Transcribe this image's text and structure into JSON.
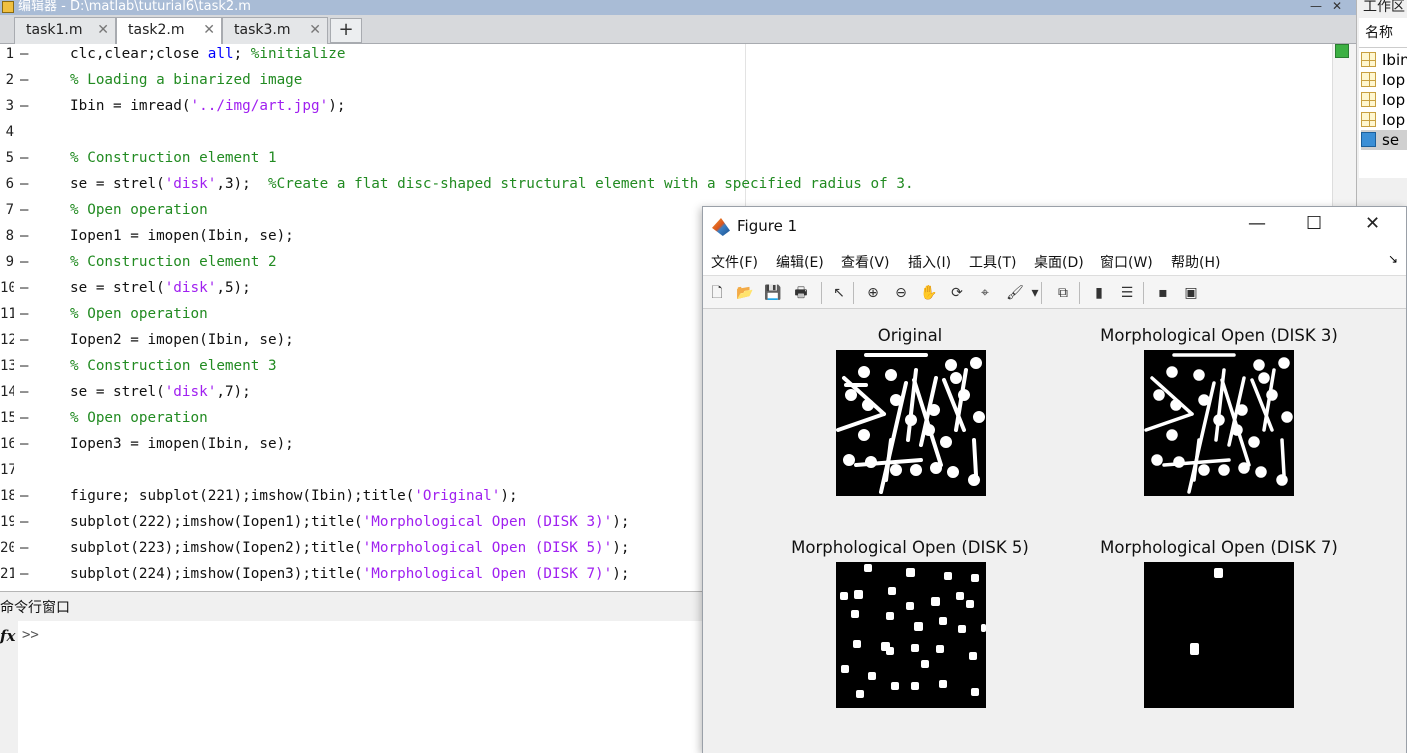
{
  "editor": {
    "title": "编辑器 - D:\\matlab\\tuturial6\\task2.m",
    "window_controls": {
      "minimize": "—",
      "close": "✕"
    },
    "tabs": [
      {
        "label": "task1.m",
        "active": false
      },
      {
        "label": "task2.m",
        "active": true
      },
      {
        "label": "task3.m",
        "active": false
      }
    ],
    "tab_close": "✕",
    "add_tab": "+",
    "line_numbers": [
      "1",
      "2",
      "3",
      "4",
      "5",
      "6",
      "7",
      "8",
      "9",
      "10",
      "11",
      "12",
      "13",
      "14",
      "15",
      "16",
      "17",
      "18",
      "19",
      "20",
      "21"
    ],
    "line_marker": "—"
  },
  "code_lines": [
    [
      [
        "p",
        "clc,clear;close "
      ],
      [
        "kw",
        "all"
      ],
      [
        "p",
        "; "
      ],
      [
        "cm",
        "%initialize"
      ]
    ],
    [
      [
        "cm",
        "% Loading a binarized image"
      ]
    ],
    [
      [
        "p",
        "Ibin = imread("
      ],
      [
        "st",
        "'../img/art.jpg'"
      ],
      [
        "p",
        ");"
      ]
    ],
    [],
    [
      [
        "cm",
        "% Construction element 1"
      ]
    ],
    [
      [
        "p",
        "se = strel("
      ],
      [
        "st",
        "'disk'"
      ],
      [
        "p",
        ",3);  "
      ],
      [
        "cm",
        "%Create a flat disc-shaped structural element with a specified radius of 3."
      ]
    ],
    [
      [
        "cm",
        "% Open operation"
      ]
    ],
    [
      [
        "p",
        "Iopen1 = imopen(Ibin, se);"
      ]
    ],
    [
      [
        "cm",
        "% Construction element 2"
      ]
    ],
    [
      [
        "p",
        "se = strel("
      ],
      [
        "st",
        "'disk'"
      ],
      [
        "p",
        ",5);"
      ]
    ],
    [
      [
        "cm",
        "% Open operation"
      ]
    ],
    [
      [
        "p",
        "Iopen2 = imopen(Ibin, se);"
      ]
    ],
    [
      [
        "cm",
        "% Construction element 3"
      ]
    ],
    [
      [
        "p",
        "se = strel("
      ],
      [
        "st",
        "'disk'"
      ],
      [
        "p",
        ",7);"
      ]
    ],
    [
      [
        "cm",
        "% Open operation"
      ]
    ],
    [
      [
        "p",
        "Iopen3 = imopen(Ibin, se);"
      ]
    ],
    [],
    [
      [
        "p",
        "figure; subplot(221);imshow(Ibin);title("
      ],
      [
        "st",
        "'Original'"
      ],
      [
        "p",
        ");"
      ]
    ],
    [
      [
        "p",
        "subplot(222);imshow(Iopen1);title("
      ],
      [
        "st",
        "'Morphological Open (DISK 3)'"
      ],
      [
        "p",
        ");"
      ]
    ],
    [
      [
        "p",
        "subplot(223);imshow(Iopen2);title("
      ],
      [
        "st",
        "'Morphological Open (DISK 5)'"
      ],
      [
        "p",
        ");"
      ]
    ],
    [
      [
        "p",
        "subplot(224);imshow(Iopen3);title("
      ],
      [
        "st",
        "'Morphological Open (DISK 7)'"
      ],
      [
        "p",
        ");"
      ]
    ]
  ],
  "workspace": {
    "title": "工作区",
    "column_header": "名称 ▲",
    "items": [
      {
        "name": "Ibin",
        "icon": "matrix-icon"
      },
      {
        "name": "Iop",
        "icon": "matrix-icon"
      },
      {
        "name": "Iop",
        "icon": "matrix-icon"
      },
      {
        "name": "Iop",
        "icon": "matrix-icon"
      },
      {
        "name": "se",
        "icon": "object-icon",
        "selected": true
      }
    ]
  },
  "command_window": {
    "title": "命令行窗口",
    "fx": "fx",
    "prompt": ">>"
  },
  "figure": {
    "title": "Figure 1",
    "controls": {
      "minimize": "—",
      "maximize": "☐",
      "close": "✕"
    },
    "menu": [
      "文件(F)",
      "编辑(E)",
      "查看(V)",
      "插入(I)",
      "工具(T)",
      "桌面(D)",
      "窗口(W)",
      "帮助(H)"
    ],
    "menu_more": "↘",
    "toolbar_icons": [
      {
        "name": "new-figure-icon",
        "glyph": "🗋"
      },
      {
        "name": "open-file-icon",
        "glyph": "📂"
      },
      {
        "name": "save-icon",
        "glyph": "💾"
      },
      {
        "name": "print-icon",
        "glyph": "🖶"
      },
      {
        "name": "pointer-icon",
        "glyph": "↖"
      },
      {
        "name": "zoom-in-icon",
        "glyph": "⊕"
      },
      {
        "name": "zoom-out-icon",
        "glyph": "⊖"
      },
      {
        "name": "pan-icon",
        "glyph": "✋"
      },
      {
        "name": "rotate-3d-icon",
        "glyph": "⟳"
      },
      {
        "name": "data-cursor-icon",
        "glyph": "⌖"
      },
      {
        "name": "brush-icon",
        "glyph": "🖌"
      },
      {
        "name": "brush-dropdown-icon",
        "glyph": "▾"
      },
      {
        "name": "link-plot-icon",
        "glyph": "⧉"
      },
      {
        "name": "colorbar-icon",
        "glyph": "▮"
      },
      {
        "name": "legend-icon",
        "glyph": "☰"
      },
      {
        "name": "hide-plot-tools-icon",
        "glyph": "▪"
      },
      {
        "name": "show-plot-tools-icon",
        "glyph": "▣"
      }
    ],
    "subplots": [
      {
        "title": "Original"
      },
      {
        "title": "Morphological Open (DISK 3)"
      },
      {
        "title": "Morphological Open (DISK 5)"
      },
      {
        "title": "Morphological Open (DISK 7)"
      }
    ]
  }
}
